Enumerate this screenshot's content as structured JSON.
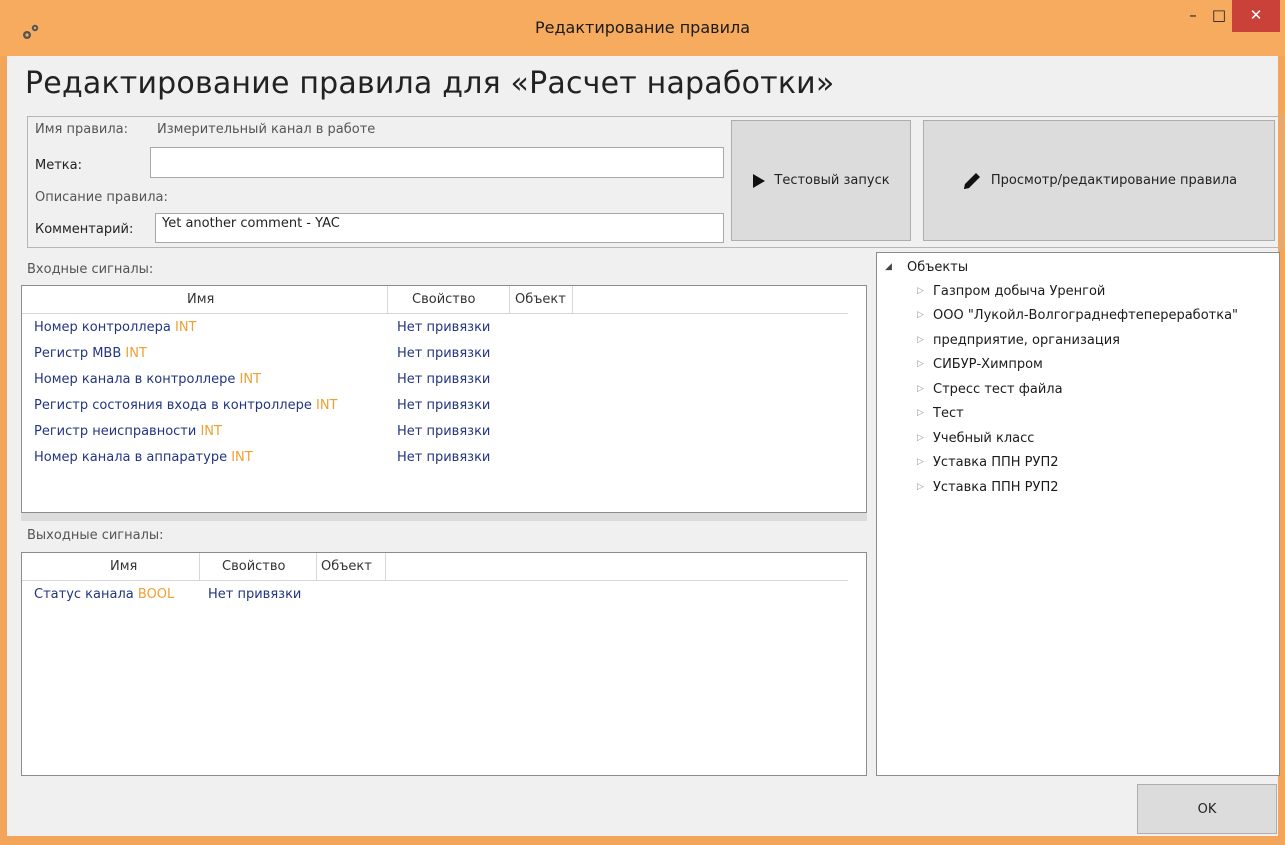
{
  "window": {
    "title": "Редактирование правила",
    "controls": {
      "minimize": "–",
      "maximize": "□",
      "close": "✕"
    },
    "accent_color": "#f6ab5e"
  },
  "heading": "Редактирование правила для «Расчет наработки»",
  "rule": {
    "name_label": "Имя правила:",
    "name_value": "Измерительный канал в работе",
    "tag_label": "Метка:",
    "tag_value": "",
    "description_label": "Описание правила:",
    "comment_label": "Комментарий:",
    "comment_value": "Yet another comment - YAC"
  },
  "buttons": {
    "test_run": "Тестовый запуск",
    "view_edit": "Просмотр/редактирование правила",
    "ok": "OK"
  },
  "inputs": {
    "label": "Входные сигналы:",
    "columns": [
      "Имя",
      "Свойство",
      "Объект"
    ],
    "rows": [
      {
        "name": "Номер контроллера",
        "type": "INT",
        "property": "Нет привязки"
      },
      {
        "name": "Регистр МВВ",
        "type": "INT",
        "property": "Нет привязки"
      },
      {
        "name": "Номер канала в контроллере",
        "type": "INT",
        "property": "Нет привязки"
      },
      {
        "name": "Регистр состояния входа в контроллере",
        "type": "INT",
        "property": "Нет привязки"
      },
      {
        "name": "Регистр неисправности",
        "type": "INT",
        "property": "Нет привязки"
      },
      {
        "name": "Номер канала в аппаратуре",
        "type": "INT",
        "property": "Нет привязки"
      }
    ]
  },
  "outputs": {
    "label": "Выходные сигналы:",
    "columns": [
      "Имя",
      "Свойство",
      "Объект"
    ],
    "rows": [
      {
        "name": "Статус канала",
        "type": "BOOL",
        "property": "Нет привязки"
      }
    ]
  },
  "tree": {
    "root": "Объекты",
    "children": [
      "Газпром добыча Уренгой",
      "ООО \"Лукойл-Волгограднефтепереработка\"",
      "предприятие, организация",
      "СИБУР-Химпром",
      "Стресс тест файла",
      "Тест",
      "Учебный класс",
      "Уставка ППН РУП2",
      "Уставка ППН РУП2"
    ]
  }
}
